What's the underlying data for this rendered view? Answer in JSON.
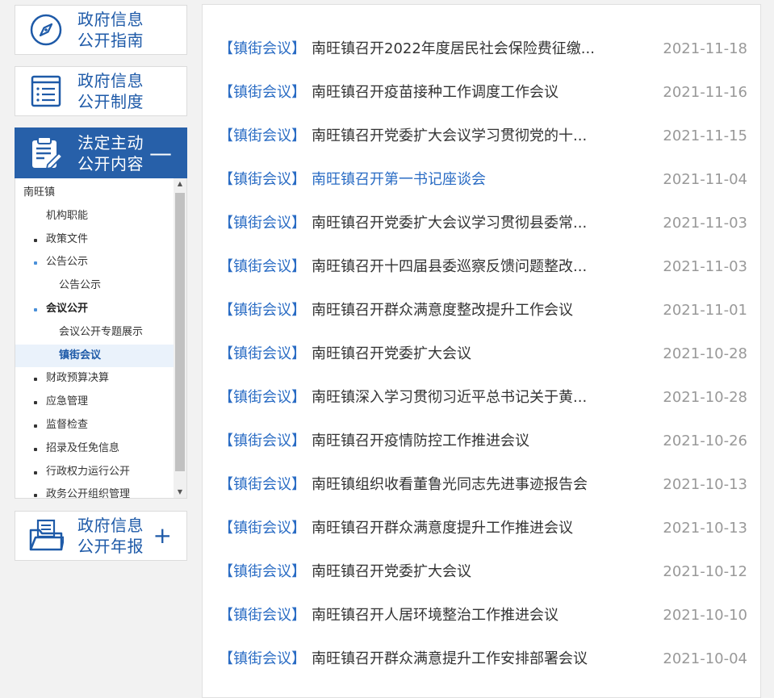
{
  "sidebar": {
    "guide": {
      "line1": "政府信息",
      "line2": "公开指南"
    },
    "system": {
      "line1": "政府信息",
      "line2": "公开制度"
    },
    "legal": {
      "line1": "法定主动",
      "line2": "公开内容",
      "toggle": "—"
    },
    "annual": {
      "line1": "政府信息",
      "line2": "公开年报",
      "toggle": "+"
    },
    "tree": [
      {
        "label": "南旺镇"
      },
      {
        "label": "机构职能"
      },
      {
        "label": "政策文件"
      },
      {
        "label": "公告公示"
      },
      {
        "label": "公告公示"
      },
      {
        "label": "会议公开"
      },
      {
        "label": "会议公开专题展示"
      },
      {
        "label": "镇街会议"
      },
      {
        "label": "财政预算决算"
      },
      {
        "label": "应急管理"
      },
      {
        "label": "监督检查"
      },
      {
        "label": "招录及任免信息"
      },
      {
        "label": "行政权力运行公开"
      },
      {
        "label": "政务公开组织管理"
      }
    ]
  },
  "news": [
    {
      "tag": "【镇街会议】",
      "title": "南旺镇召开2022年度居民社会保险费征缴...",
      "date": "2021-11-18"
    },
    {
      "tag": "【镇街会议】",
      "title": "南旺镇召开疫苗接种工作调度工作会议",
      "date": "2021-11-16"
    },
    {
      "tag": "【镇街会议】",
      "title": "南旺镇召开党委扩大会议学习贯彻党的十...",
      "date": "2021-11-15"
    },
    {
      "tag": "【镇街会议】",
      "title": "南旺镇召开第一书记座谈会",
      "date": "2021-11-04"
    },
    {
      "tag": "【镇街会议】",
      "title": "南旺镇召开党委扩大会议学习贯彻县委常...",
      "date": "2021-11-03"
    },
    {
      "tag": "【镇街会议】",
      "title": "南旺镇召开十四届县委巡察反馈问题整改...",
      "date": "2021-11-03"
    },
    {
      "tag": "【镇街会议】",
      "title": "南旺镇召开群众满意度整改提升工作会议",
      "date": "2021-11-01"
    },
    {
      "tag": "【镇街会议】",
      "title": "南旺镇召开党委扩大会议",
      "date": "2021-10-28"
    },
    {
      "tag": "【镇街会议】",
      "title": "南旺镇深入学习贯彻习近平总书记关于黄...",
      "date": "2021-10-28"
    },
    {
      "tag": "【镇街会议】",
      "title": "南旺镇召开疫情防控工作推进会议",
      "date": "2021-10-26"
    },
    {
      "tag": "【镇街会议】",
      "title": "南旺镇组织收看董鲁光同志先进事迹报告会",
      "date": "2021-10-13"
    },
    {
      "tag": "【镇街会议】",
      "title": "南旺镇召开群众满意度提升工作推进会议",
      "date": "2021-10-13"
    },
    {
      "tag": "【镇街会议】",
      "title": "南旺镇召开党委扩大会议",
      "date": "2021-10-12"
    },
    {
      "tag": "【镇街会议】",
      "title": "南旺镇召开人居环境整治工作推进会议",
      "date": "2021-10-10"
    },
    {
      "tag": "【镇街会议】",
      "title": "南旺镇召开群众满意提升工作安排部署会议",
      "date": "2021-10-04"
    }
  ],
  "colors": {
    "brand_blue": "#2760a9",
    "link_blue": "#2a6cc4",
    "date_gray": "#999999"
  },
  "icons": {
    "guide": "compass-icon",
    "system": "document-list-icon",
    "legal": "clipboard-edit-icon",
    "annual": "folder-document-icon"
  }
}
